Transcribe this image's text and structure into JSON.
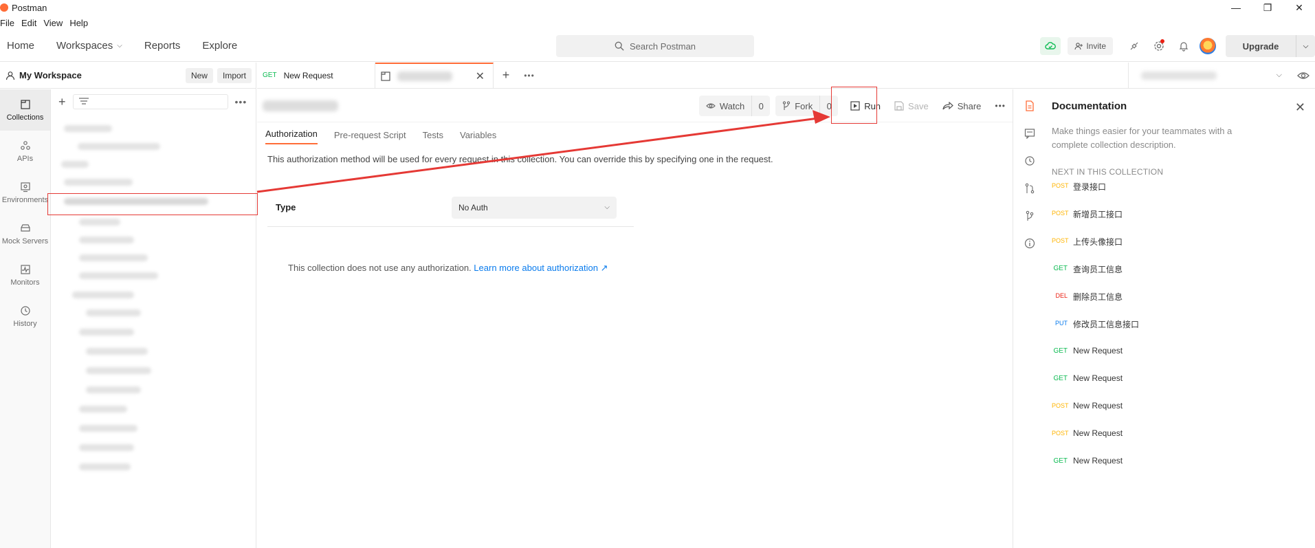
{
  "app": {
    "title": "Postman"
  },
  "menu": [
    "File",
    "Edit",
    "View",
    "Help"
  ],
  "nav": {
    "home": "Home",
    "workspaces": "Workspaces",
    "reports": "Reports",
    "explore": "Explore",
    "search_placeholder": "Search Postman",
    "invite": "Invite",
    "upgrade": "Upgrade"
  },
  "sidebar": {
    "workspace_name": "My Workspace",
    "new_label": "New",
    "import_label": "Import",
    "rail": [
      {
        "label": "Collections",
        "icon": "collections-icon"
      },
      {
        "label": "APIs",
        "icon": "apis-icon"
      },
      {
        "label": "Environments",
        "icon": "environments-icon"
      },
      {
        "label": "Mock Servers",
        "icon": "mock-servers-icon"
      },
      {
        "label": "Monitors",
        "icon": "monitors-icon"
      },
      {
        "label": "History",
        "icon": "history-icon"
      }
    ]
  },
  "tabs": [
    {
      "method": "GET",
      "label": "New Request"
    }
  ],
  "header": {
    "watch_label": "Watch",
    "watch_count": "0",
    "fork_label": "Fork",
    "fork_count": "0",
    "run_label": "Run",
    "save_label": "Save",
    "share_label": "Share"
  },
  "subtabs": [
    "Authorization",
    "Pre-request Script",
    "Tests",
    "Variables"
  ],
  "auth": {
    "description": "This authorization method will be used for every request in this collection. You can override this by specifying one in the request.",
    "type_label": "Type",
    "type_value": "No Auth",
    "empty_message": "This collection does not use any authorization.",
    "learn_more": "Learn more about authorization ↗"
  },
  "docs": {
    "title": "Documentation",
    "description": "Make things easier for your teammates with a complete collection description.",
    "next_heading": "NEXT IN THIS COLLECTION",
    "requests": [
      {
        "method": "POST",
        "name": "登录接口"
      },
      {
        "method": "POST",
        "name": "新增员工接口"
      },
      {
        "method": "POST",
        "name": "上传头像接口"
      },
      {
        "method": "GET",
        "name": "查询员工信息"
      },
      {
        "method": "DEL",
        "name": "删除员工信息"
      },
      {
        "method": "PUT",
        "name": "修改员工信息接口"
      },
      {
        "method": "GET",
        "name": "New Request"
      },
      {
        "method": "GET",
        "name": "New Request"
      },
      {
        "method": "POST",
        "name": "New Request"
      },
      {
        "method": "POST",
        "name": "New Request"
      },
      {
        "method": "GET",
        "name": "New Request"
      }
    ]
  },
  "colors": {
    "accent": "#ff6c37",
    "annotation": "#e53935",
    "get": "#0cbb52",
    "post": "#ffb400",
    "del": "#eb2013",
    "put": "#097bed"
  }
}
